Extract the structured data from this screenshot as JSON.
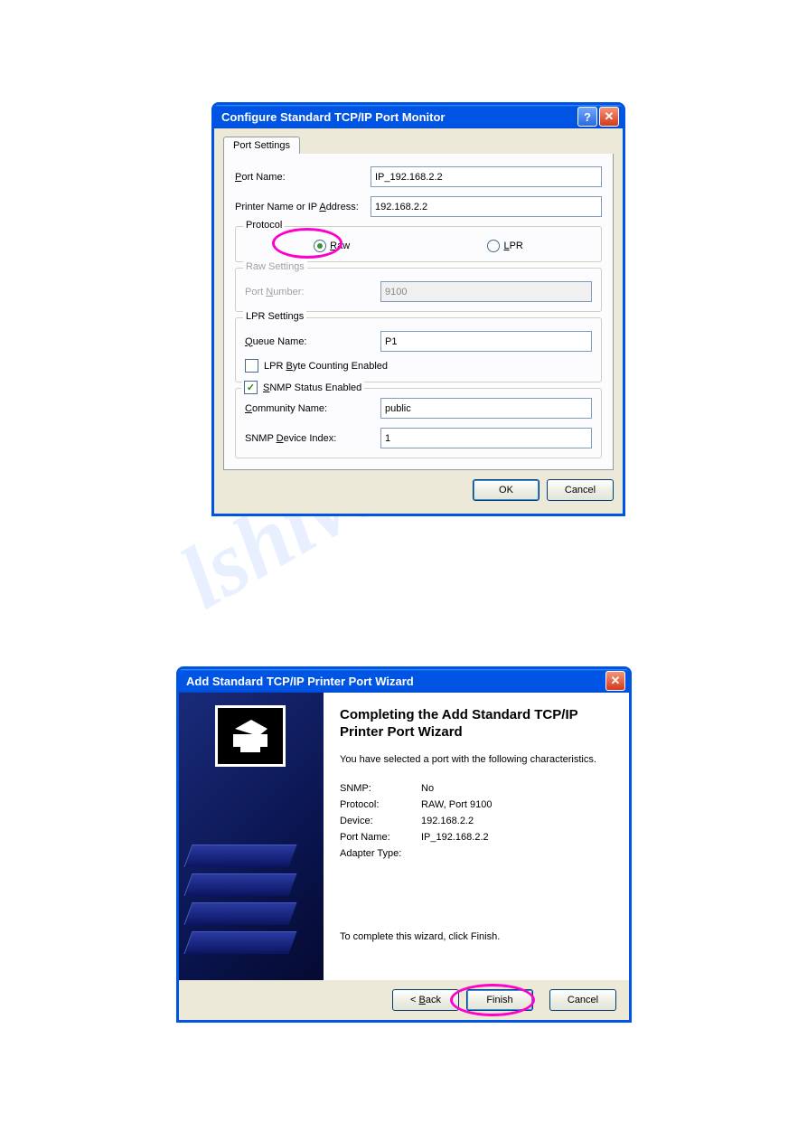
{
  "watermark_text": "lshive.com",
  "dialog1": {
    "title": "Configure Standard TCP/IP Port Monitor",
    "tab_label": "Port Settings",
    "port_name_label": "Port Name:",
    "port_name_value": "IP_192.168.2.2",
    "printer_addr_label": "Printer Name or IP Address:",
    "printer_addr_value": "192.168.2.2",
    "protocol_legend": "Protocol",
    "protocol_raw": "Raw",
    "protocol_lpr": "LPR",
    "raw_legend": "Raw Settings",
    "raw_port_label": "Port Number:",
    "raw_port_value": "9100",
    "lpr_legend": "LPR Settings",
    "lpr_queue_label": "Queue Name:",
    "lpr_queue_value": "P1",
    "lpr_byte_label": "LPR Byte Counting Enabled",
    "snmp_enabled_label": "SNMP Status Enabled",
    "snmp_comm_label": "Community Name:",
    "snmp_comm_value": "public",
    "snmp_index_label": "SNMP Device Index:",
    "snmp_index_value": "1",
    "ok": "OK",
    "cancel": "Cancel"
  },
  "dialog2": {
    "title": "Add Standard TCP/IP Printer Port Wizard",
    "heading": "Completing the Add Standard TCP/IP Printer Port Wizard",
    "subtext": "You have selected a port with the following characteristics.",
    "props": {
      "snmp_k": "SNMP:",
      "snmp_v": "No",
      "proto_k": "Protocol:",
      "proto_v": "RAW, Port 9100",
      "dev_k": "Device:",
      "dev_v": "192.168.2.2",
      "port_k": "Port Name:",
      "port_v": "IP_192.168.2.2",
      "adapter_k": "Adapter Type:",
      "adapter_v": ""
    },
    "footer": "To complete this wizard, click Finish.",
    "back": "< Back",
    "finish": "Finish",
    "cancel": "Cancel"
  }
}
